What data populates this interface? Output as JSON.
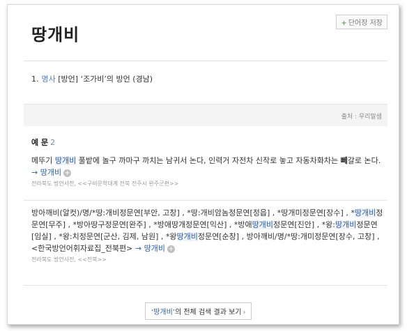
{
  "save_button": {
    "plus": "+",
    "label": "단어장 저장"
  },
  "title": "땅개비",
  "sense": {
    "number": "1.",
    "pos": "명사",
    "definition": "[방언] ‘조가비’의 방언 (경남)"
  },
  "source": {
    "label": "출처 : 우리말샘"
  },
  "examples_header": {
    "label": "예 문",
    "count": "2"
  },
  "examples": [
    {
      "parts": [
        "메뚜기 ",
        "땅개비",
        " 풀밭에 놀구 까마구 까치는 남귀서 논다, 인력거 자전차 신작로 놓고 자동차화차는 ",
        "뻬",
        "갈로 논다."
      ],
      "link": "→ 땅개비",
      "plus": "+",
      "citation": "전라북도 방언사전, <<구비문학대계 전북 전주시 완주군편>>"
    },
    {
      "parts": [
        "방아깨비(알컷)/명/*땅:개비정문연[부안, 고창] , *땅:개비암놈정문연[정읍] , *땅개미정문연[장수] , *",
        "땅개비",
        "정문연[무주] , *방아땅구정문연[완주] , *방애땅개정문연[익산] , *방애",
        "땅개비",
        "정문연[진안] , *왕:",
        "땅개비",
        "정문연[임실] , *왕:치정문연[군산, 김제, 남원] , *왕",
        "땅개비",
        "정문연[순창] , 방아깨비/명/*땅:개미정문연[장수, 고창] , <한국방언어휘자료집_전북편>"
      ],
      "link": "→ 땅개비",
      "plus": "+",
      "citation": "전라북도 방언사전, <<전북>>"
    }
  ],
  "more_link": {
    "keyword": "‘땅개비’",
    "rest": "의 전체 검색 결과 보기",
    "chevron": "›"
  }
}
